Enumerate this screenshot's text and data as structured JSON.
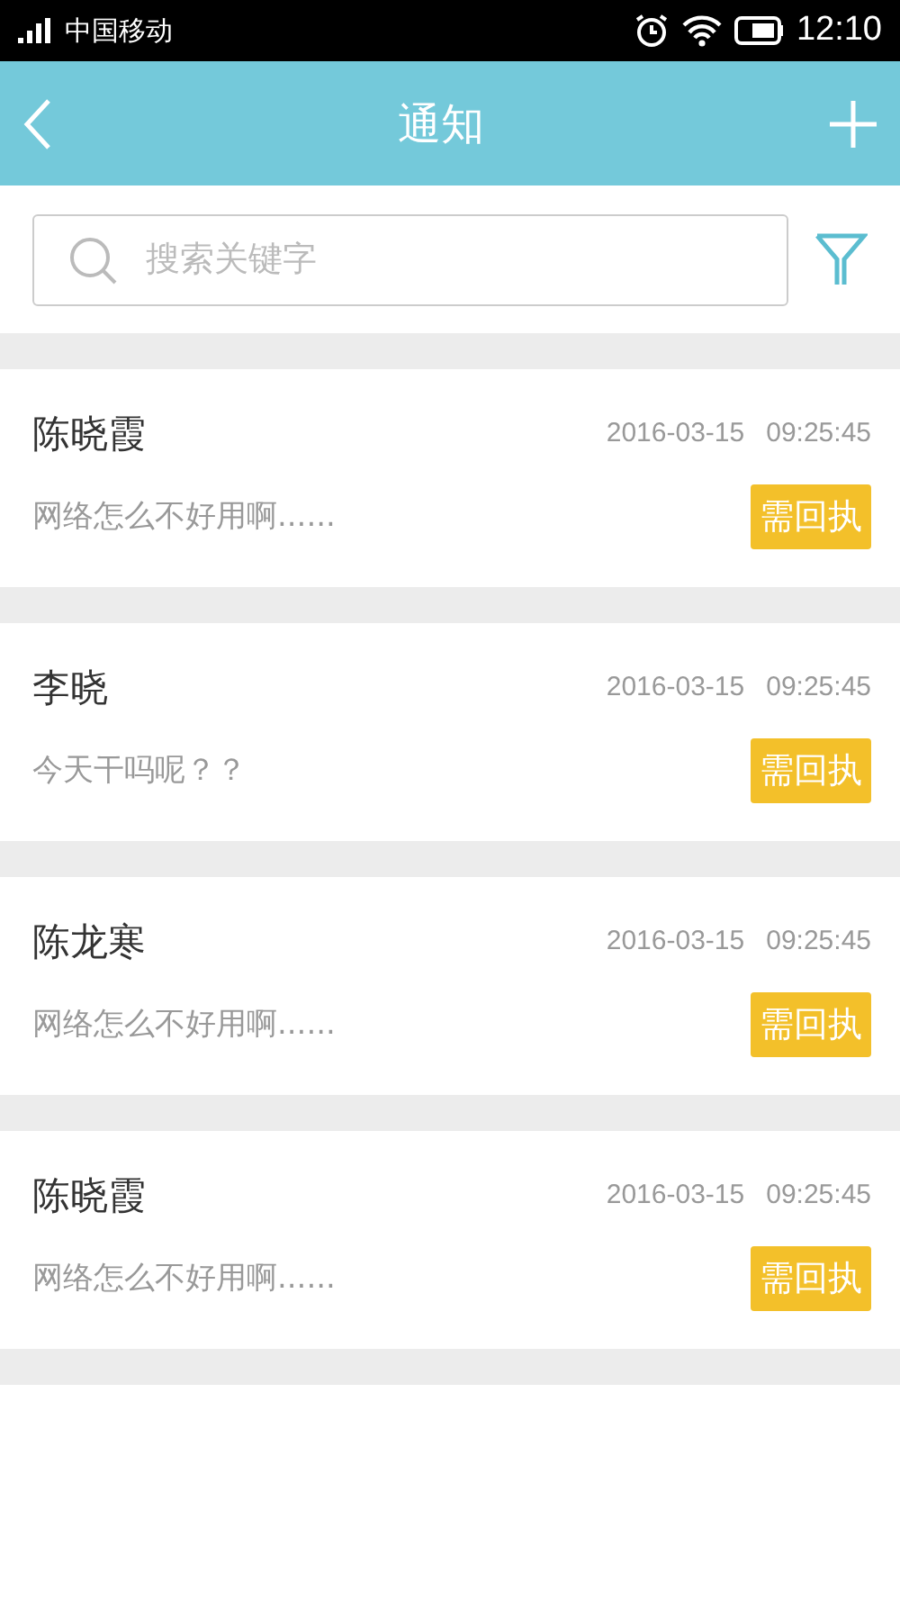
{
  "status_bar": {
    "carrier": "中国移动",
    "time": "12:10"
  },
  "header": {
    "title": "通知"
  },
  "search": {
    "placeholder": "搜索关键字"
  },
  "notices": [
    {
      "name": "陈晓霞",
      "date": "2016-03-15",
      "time": "09:25:45",
      "message": "网络怎么不好用啊......",
      "badge": "需回执"
    },
    {
      "name": "李晓",
      "date": "2016-03-15",
      "time": "09:25:45",
      "message": "今天干吗呢？？",
      "badge": "需回执"
    },
    {
      "name": "陈龙寒",
      "date": "2016-03-15",
      "time": "09:25:45",
      "message": "网络怎么不好用啊......",
      "badge": "需回执"
    },
    {
      "name": "陈晓霞",
      "date": "2016-03-15",
      "time": "09:25:45",
      "message": "网络怎么不好用啊......",
      "badge": "需回执"
    }
  ]
}
